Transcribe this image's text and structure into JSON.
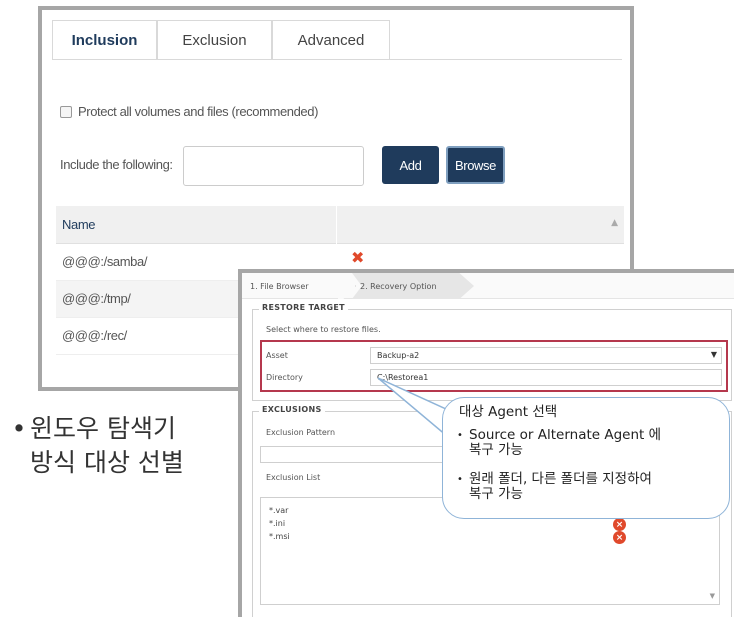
{
  "panel1": {
    "tabs": [
      {
        "label": "Inclusion",
        "active": true
      },
      {
        "label": "Exclusion",
        "active": false
      },
      {
        "label": "Advanced",
        "active": false
      }
    ],
    "protect_all_label": "Protect all volumes and files (recommended)",
    "include_label": "Include the following:",
    "include_value": "",
    "add_label": "Add",
    "browse_label": "Browse",
    "table": {
      "name_header": "Name",
      "rows": [
        "@@@:/samba/",
        "@@@:/tmp/",
        "@@@:/rec/"
      ]
    }
  },
  "bullet": {
    "dot": "•",
    "line1": "윈도우 탐색기",
    "line2": "방식 대상 선별"
  },
  "panel2": {
    "steps": [
      "1. File Browser",
      "2. Recovery Option"
    ],
    "restore_target": {
      "title": "RESTORE TARGET",
      "hint": "Select where to restore files.",
      "asset_label": "Asset",
      "asset_value": "Backup-a2",
      "directory_label": "Directory",
      "directory_value": "C:\\Restorea1"
    },
    "exclusions": {
      "title": "EXCLUSIONS",
      "pattern_label": "Exclusion Pattern",
      "list_label": "Exclusion List",
      "items": [
        "*.var",
        "*.ini",
        "*.msi"
      ]
    }
  },
  "callout": {
    "title": "대상 Agent 선택",
    "bullets": [
      {
        "dot": "•",
        "line1": "Source or Alternate Agent 에",
        "line2": "복구 가능"
      },
      {
        "dot": "•",
        "line1": "원래 폴더, 다른 폴더를 지정하여",
        "line2": "복구 가능"
      }
    ]
  },
  "colors": {
    "navy": "#1f3b5c",
    "highlight_red": "#b5384d",
    "delete_red": "#e0492b",
    "callout_border": "#8fb4d8"
  }
}
